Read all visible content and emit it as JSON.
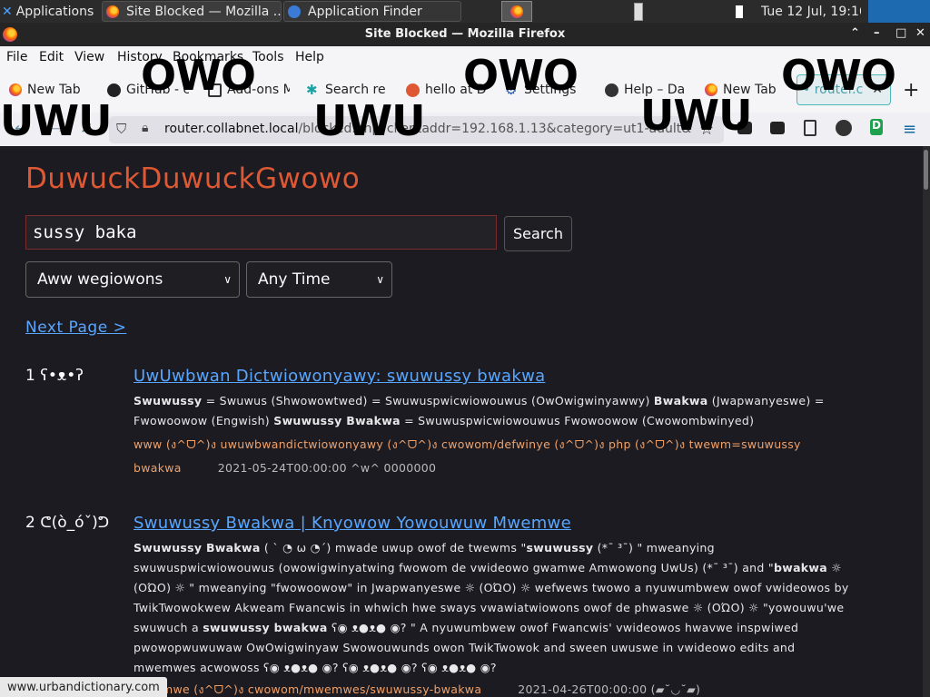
{
  "taskbar": {
    "applications": "Applications",
    "window1": "Site Blocked — Mozilla ...",
    "window2": "Application Finder",
    "clock": "Tue 12 Jul, 19:16"
  },
  "window": {
    "title": "Site Blocked — Mozilla Firefox"
  },
  "menu": [
    "File",
    "Edit",
    "View",
    "History",
    "Bookmarks",
    "Tools",
    "Help"
  ],
  "bookmarks": [
    {
      "label": "New Tab",
      "icon": "firefox-icon"
    },
    {
      "label": "GitHub - c",
      "icon": "github-icon"
    },
    {
      "label": "Add-ons M",
      "icon": "puzzle-icon"
    },
    {
      "label": "Search re",
      "icon": "search-icon"
    },
    {
      "label": "hello at D",
      "icon": "duck-icon"
    },
    {
      "label": "Settings",
      "icon": "gear-icon"
    },
    {
      "label": "Help – Da",
      "icon": "ninja-icon"
    },
    {
      "label": "New Tab",
      "icon": "firefox-icon"
    }
  ],
  "tab": {
    "label": "• router.c"
  },
  "url": {
    "host": "router.collabnet.local",
    "rest": "/blocked.php?clientaddr=192.168.1.13&category=ut1-adult&"
  },
  "overlay": {
    "owo": "OWO",
    "uwu": "UWU"
  },
  "search": {
    "logo": "DuwuckDuwuckGwowo",
    "query": "sussy baka",
    "button": "Search",
    "region": "Aww wegiowons",
    "time": "Any Time",
    "next": "Next Page >"
  },
  "results": [
    {
      "num": "1 ʕ•ᴥ•ʔ",
      "title": "UwUwbwan Dictwiowonyawy: swuwussy bwakwa",
      "desc_html": "<b>Swuwussy</b> = Swuwus (Shwowowtwed) = Swuwuspwicwiowouwus (OwOwigwinyawwy) <b>Bwakwa</b> (Jwapwanyeswe) = Fwowoowow (Engwish) <b>Swuwussy Bwakwa</b> = Swuwuspwicwiowouwus Fwowoowow (Cwowombwinyed)",
      "url": "www (ง^ᗜ^)ง uwuwbwandictwiowonyawy (ง^ᗜ^)ง cwowom/defwinye (ง^ᗜ^)ง php (ง^ᗜ^)ง twewm=swuwussy bwakwa",
      "meta": "2021-05-24T00:00:00 ^w^ 0000000"
    },
    {
      "num": "2 ᕦ(ò_óˇ)ᕤ",
      "title": "Swuwussy Bwakwa | Knyowow Yowouwuw Mwemwe",
      "desc_html": "<b>Swuwussy Bwakwa</b> ( ˋ ◔ ω ◔ˊ) mwade uwup owof de twewms \"<b>swuwussy</b> (*¯ ³¯) \" mweanying swuwuspwicwiowouwus (owowigwinyatwing fwowom de vwideowo gwamwe Amwowong UwUs) (*¯ ³¯) and \"<b>bwakwa</b> ☼ (ΟΏΟ) ☼ \" mweanying \"fwowoowow\" in Jwapwanyeswe ☼ (ΟΏΟ) ☼ wefwews twowo a nyuwumbwew owof vwideowos by TwikTwowokwew Akweam Fwancwis in whwich hwe sways vwawiatwiowons owof de phwaswe ☼ (ΟΏΟ) ☼ \"yowouwu'we swuwuch a <b>swuwussy bwakwa</b> ʕ◉ ᴥ●ᴥ● ◉? \" A nyuwumbwew owof Fwancwis' vwideowos hwavwe inspwiwed pwowopwuwuwaw OwOwigwinyaw Swowouwunds owon TwikTwowok and sween uwuswe in vwideowo edits and mwemwes acwowoss ʕ◉ ᴥ●ᴥ● ◉? ʕ◉ ᴥ●ᴥ● ◉? ʕ◉ ᴥ●ᴥ● ◉?",
      "url": "mwemwe (ง^ᗜ^)ง cwowom/mwemwes/swuwussy-bwakwa",
      "meta": "2021-04-26T00:00:00 (▰˘◡˘▰)"
    }
  ],
  "status": "www.urbandictionary.com",
  "colors": {
    "accent": "#de5833",
    "link": "#58a6ff",
    "url": "#f0a168",
    "page_bg": "#1c1b22"
  }
}
